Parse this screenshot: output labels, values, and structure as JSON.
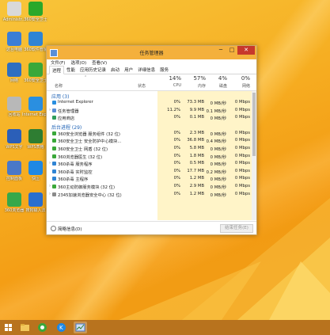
{
  "desktop": {
    "icons": [
      {
        "label": "Administr...",
        "color": "#d9d9d9",
        "glyph": "user-folder-icon"
      },
      {
        "label": "360安全卫士",
        "color": "#2aa82a",
        "glyph": "360-safe-icon"
      },
      {
        "label": "这台电脑",
        "color": "#3b7ed6",
        "glyph": "computer-icon"
      },
      {
        "label": "360软件管家",
        "color": "#2f84d4",
        "glyph": "software-manager-icon"
      },
      {
        "label": "网络",
        "color": "#2e6fc1",
        "glyph": "network-icon"
      },
      {
        "label": "360安全卫士",
        "color": "#3aa83a",
        "glyph": "shield-icon"
      },
      {
        "label": "回收站",
        "color": "#b8b8b8",
        "glyph": "recycle-bin-icon"
      },
      {
        "label": "Internet Explorer",
        "color": "#2a8fe0",
        "glyph": "ie-icon"
      },
      {
        "label": "WPS文字",
        "color": "#2b5fb8",
        "glyph": "wps-writer-icon"
      },
      {
        "label": "WPS表格",
        "color": "#2e7d32",
        "glyph": "wps-sheet-icon"
      },
      {
        "label": "控制面板",
        "color": "#4a78c8",
        "glyph": "control-panel-icon"
      },
      {
        "label": "快压",
        "color": "#1e88e5",
        "glyph": "kuaiya-icon"
      },
      {
        "label": "360浏览器",
        "color": "#37a84a",
        "glyph": "360-browser-icon"
      },
      {
        "label": "搜狗输入法",
        "color": "#2a6fcf",
        "glyph": "sogou-icon"
      }
    ]
  },
  "window": {
    "title": "任务管理器",
    "controls": {
      "minimize": "─",
      "maximize": "□",
      "close": "✕"
    },
    "menu": [
      "文件(F)",
      "选项(O)",
      "查看(V)"
    ],
    "tabs": [
      "进程",
      "性能",
      "应用历史记录",
      "启动",
      "用户",
      "详细信息",
      "服务"
    ],
    "active_tab": "进程",
    "columns": {
      "name": "名称",
      "status": "状态",
      "cpu": {
        "pct": "14%",
        "label": "CPU"
      },
      "memory": {
        "pct": "57%",
        "label": "内存"
      },
      "disk": {
        "pct": "4%",
        "label": "磁盘"
      },
      "network": {
        "pct": "0%",
        "label": "网络"
      }
    },
    "groups": [
      {
        "title": "应用 (3)",
        "rows": [
          {
            "expand": "",
            "icon": "ie-icon",
            "icon_color": "#2a8fe0",
            "name": "Internet Explorer",
            "cpu": "0%",
            "mem": "73.3 MB",
            "disk": "0 MB/秒",
            "net": "0 Mbps"
          },
          {
            "expand": "›",
            "icon": "task-manager-icon",
            "icon_color": "#5a8fd6",
            "name": "任务管理器",
            "cpu": "11.2%",
            "mem": "9.9 MB",
            "disk": "0.1 MB/秒",
            "net": "0 Mbps"
          },
          {
            "expand": "",
            "icon": "store-icon",
            "icon_color": "#2e9e5b",
            "name": "应用商店",
            "cpu": "0%",
            "mem": "0.1 MB",
            "disk": "0 MB/秒",
            "net": "0 Mbps"
          }
        ]
      },
      {
        "title": "后台进程 (29)",
        "rows": [
          {
            "expand": "",
            "icon": "360-icon",
            "icon_color": "#3aa83a",
            "name": "360安全浏览器 服务组件 (32 位)",
            "cpu": "0%",
            "mem": "2.3 MB",
            "disk": "0 MB/秒",
            "net": "0 Mbps"
          },
          {
            "expand": "",
            "icon": "360-icon",
            "icon_color": "#3aa83a",
            "name": "360安全卫士 安全防护中心模块...",
            "cpu": "0%",
            "mem": "36.8 MB",
            "disk": "0.4 MB/秒",
            "net": "0 Mbps"
          },
          {
            "expand": "",
            "icon": "360-icon",
            "icon_color": "#3aa83a",
            "name": "360安全卫士 网盾 (32 位)",
            "cpu": "0%",
            "mem": "5.8 MB",
            "disk": "0 MB/秒",
            "net": "0 Mbps"
          },
          {
            "expand": "",
            "icon": "360-icon",
            "icon_color": "#3aa83a",
            "name": "360浏览器医生 (32 位)",
            "cpu": "0%",
            "mem": "1.8 MB",
            "disk": "0 MB/秒",
            "net": "0 Mbps"
          },
          {
            "expand": "›",
            "icon": "360-icon",
            "icon_color": "#2f84d4",
            "name": "360杀毒 服务程序",
            "cpu": "0%",
            "mem": "0.5 MB",
            "disk": "0 MB/秒",
            "net": "0 Mbps"
          },
          {
            "expand": "",
            "icon": "360-icon",
            "icon_color": "#2f84d4",
            "name": "360杀毒 实时监控",
            "cpu": "0%",
            "mem": "17.7 MB",
            "disk": "0.2 MB/秒",
            "net": "0 Mbps"
          },
          {
            "expand": "",
            "icon": "360-icon",
            "icon_color": "#2f84d4",
            "name": "360杀毒 主程序",
            "cpu": "0%",
            "mem": "1.2 MB",
            "disk": "0 MB/秒",
            "net": "0 Mbps"
          },
          {
            "expand": "›",
            "icon": "360-icon",
            "icon_color": "#3aa83a",
            "name": "360主动防御服务模块 (32 位)",
            "cpu": "0%",
            "mem": "2.9 MB",
            "disk": "0 MB/秒",
            "net": "0 Mbps"
          },
          {
            "expand": "›",
            "icon": "app-icon",
            "icon_color": "#8a8a8a",
            "name": "2345加速浏览器安全中心 (32 位)",
            "cpu": "0%",
            "mem": "1.2 MB",
            "disk": "0 MB/秒",
            "net": "0 Mbps"
          }
        ]
      }
    ],
    "footer": {
      "fewer_details": "简略信息(D)",
      "end_task": "结束任务(E)"
    }
  },
  "taskbar": {
    "items": [
      "start-button",
      "file-explorer",
      "360-browser",
      "kuaiya",
      "task-manager"
    ]
  }
}
